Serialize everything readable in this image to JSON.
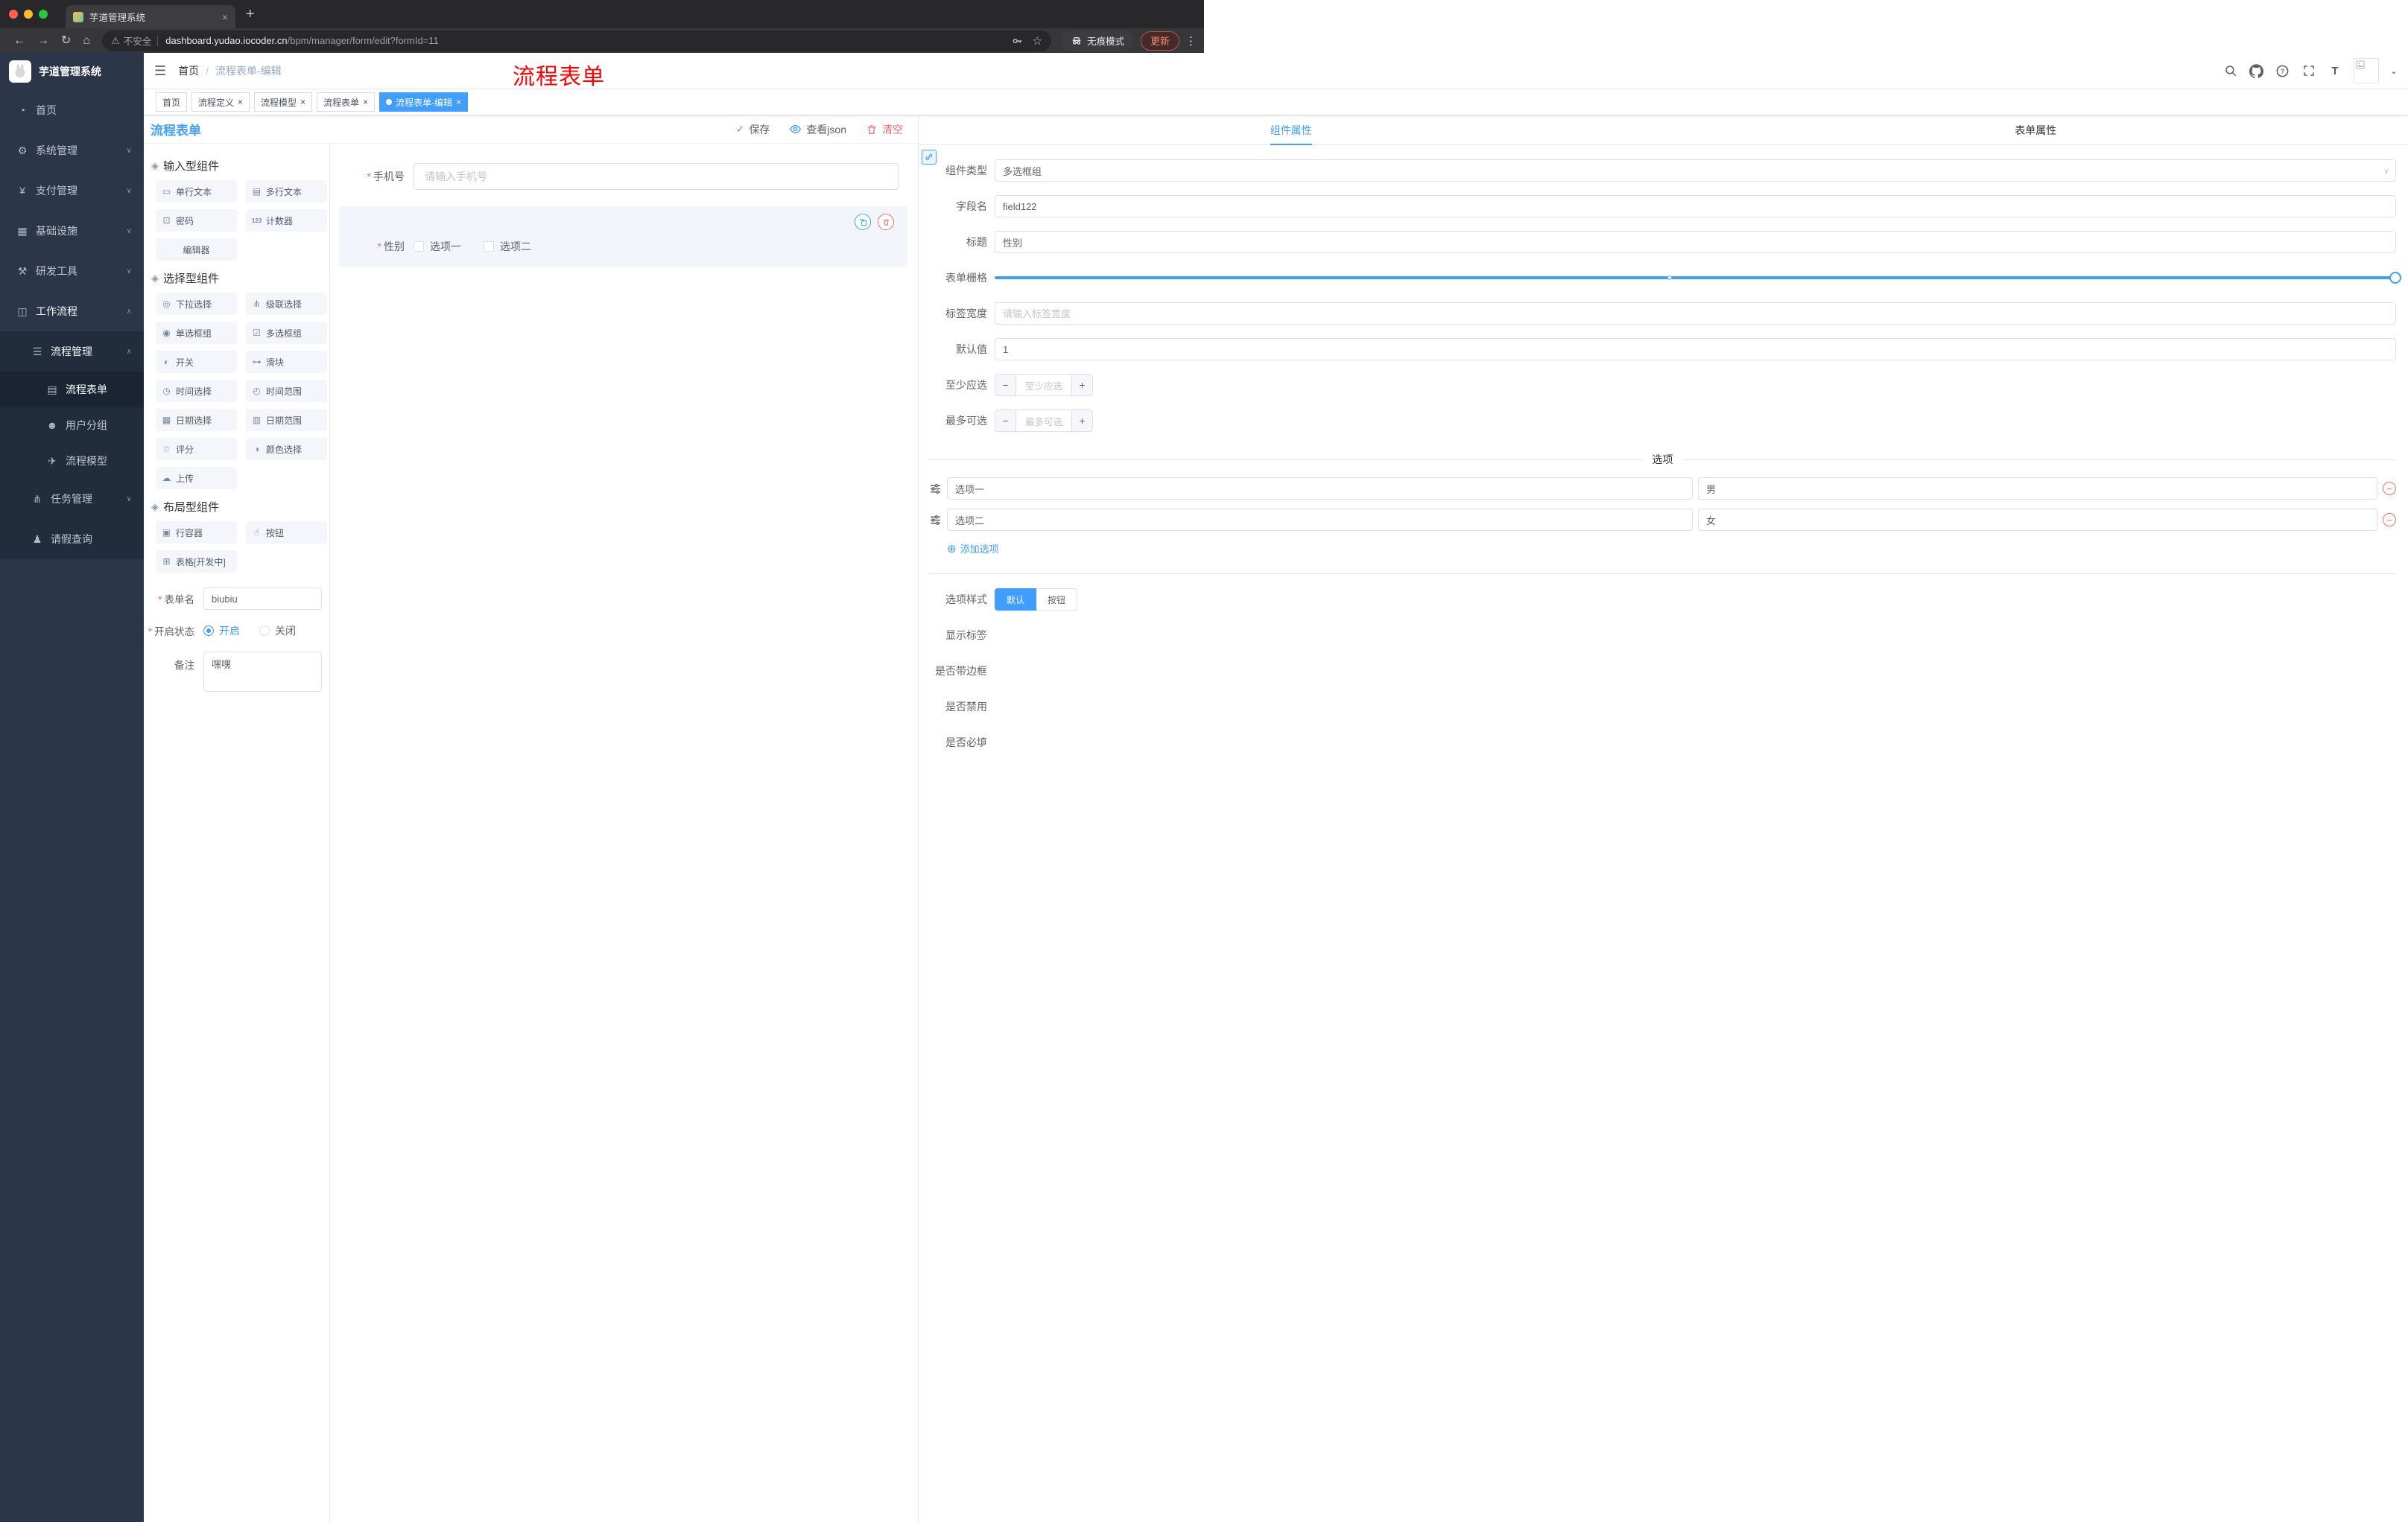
{
  "colors": {
    "accent": "#409eff",
    "danger": "#f56c6c",
    "annotation_red": "#ff0000",
    "sidebar_bg": "#2b3648"
  },
  "icons": {
    "close": "×",
    "plus": "+",
    "back": "←",
    "forward": "→",
    "reload": "↻",
    "home": "⌂",
    "warning": "⚠",
    "star": "☆",
    "dots_vertical": "⋮",
    "hamburger": "☰",
    "chevron_down": "∨",
    "chevron_up": "∧",
    "check": "✓",
    "add_circle": "⊕",
    "minus": "−",
    "slash": "/",
    "caret": "⌄",
    "text_size": "T"
  },
  "browser": {
    "tab_title": "芋道管理系统",
    "security_label": "不安全",
    "url_domain": "dashboard.yudao.iocoder.cn",
    "url_path": "/bpm/manager/form/edit?formId=11",
    "incognito_label": "无痕模式",
    "update_label": "更新"
  },
  "sidebar": {
    "logo_text": "芋道管理系统",
    "items": [
      {
        "label": "首页",
        "icon": "◔"
      },
      {
        "label": "系统管理",
        "icon": "⚙"
      },
      {
        "label": "支付管理",
        "icon": "¥"
      },
      {
        "label": "基础设施",
        "icon": "▦"
      },
      {
        "label": "研发工具",
        "icon": "⚒"
      },
      {
        "label": "工作流程",
        "icon": "◫"
      }
    ],
    "submenu": {
      "process_management": {
        "label": "流程管理",
        "icon": "☰"
      },
      "children": [
        {
          "label": "流程表单",
          "icon": "▤"
        },
        {
          "label": "用户分组",
          "icon": "☻"
        },
        {
          "label": "流程模型",
          "icon": "✈"
        }
      ],
      "task_management": {
        "label": "任务管理",
        "icon": "⋔"
      },
      "leave_query": {
        "label": "请假查询",
        "icon": "♟"
      }
    }
  },
  "header": {
    "breadcrumb": [
      "首页",
      "流程表单-编辑"
    ],
    "annotation": "流程表单"
  },
  "tags": {
    "items": [
      {
        "label": "首页"
      },
      {
        "label": "流程定义"
      },
      {
        "label": "流程模型"
      },
      {
        "label": "流程表单"
      },
      {
        "label": "流程表单-编辑"
      }
    ]
  },
  "designer": {
    "title": "流程表单",
    "actions": {
      "save": "保存",
      "view_json": "查看json",
      "clear": "清空"
    },
    "palette": {
      "sections": [
        {
          "title": "输入型组件",
          "items": [
            {
              "label": "单行文本",
              "icon": "▭"
            },
            {
              "label": "多行文本",
              "icon": "▤"
            },
            {
              "label": "密码",
              "icon": "⊡"
            },
            {
              "label": "计数器",
              "icon": "123"
            },
            {
              "label": "编辑器",
              "icon": ""
            }
          ]
        },
        {
          "title": "选择型组件",
          "items": [
            {
              "label": "下拉选择",
              "icon": "◎"
            },
            {
              "label": "级联选择",
              "icon": "⋔"
            },
            {
              "label": "单选框组",
              "icon": "◉"
            },
            {
              "label": "多选框组",
              "icon": "☑"
            },
            {
              "label": "开关",
              "icon": "◐"
            },
            {
              "label": "滑块",
              "icon": "⊶"
            },
            {
              "label": "时间选择",
              "icon": "◷"
            },
            {
              "label": "时间范围",
              "icon": "◴"
            },
            {
              "label": "日期选择",
              "icon": "▦"
            },
            {
              "label": "日期范围",
              "icon": "▥"
            },
            {
              "label": "评分",
              "icon": "☆"
            },
            {
              "label": "颜色选择",
              "icon": "◑"
            },
            {
              "label": "上传",
              "icon": "☁"
            }
          ]
        },
        {
          "title": "布局型组件",
          "items": [
            {
              "label": "行容器",
              "icon": "▣"
            },
            {
              "label": "按钮",
              "icon": "☝"
            },
            {
              "label": "表格[开发中]",
              "icon": "⊞"
            }
          ]
        }
      ]
    },
    "form_meta": {
      "form_name": {
        "label": "表单名",
        "value": "biubiu"
      },
      "status": {
        "label": "开启状态",
        "options": [
          "开启",
          "关闭"
        ],
        "selected": "开启"
      },
      "remark": {
        "label": "备注",
        "value": "嘿嘿"
      }
    },
    "canvas": {
      "phone": {
        "label": "手机号",
        "placeholder": "请输入手机号"
      },
      "gender": {
        "label": "性别",
        "options": [
          "选项一",
          "选项二"
        ]
      }
    }
  },
  "props": {
    "tabs": [
      {
        "label": "组件属性"
      },
      {
        "label": "表单属性"
      }
    ],
    "component_type": {
      "label": "组件类型",
      "value": "多选框组"
    },
    "field_name": {
      "label": "字段名",
      "value": "field122"
    },
    "title_field": {
      "label": "标题",
      "value": "性别"
    },
    "grid": {
      "label": "表单栅格",
      "value": 24,
      "max": 24
    },
    "label_width": {
      "label": "标签宽度",
      "placeholder": "请输入标签宽度"
    },
    "default_value": {
      "label": "默认值",
      "value": "1"
    },
    "min_select": {
      "label": "至少应选",
      "placeholder": "至少应选"
    },
    "max_select": {
      "label": "最多可选",
      "placeholder": "最多可选"
    },
    "options_title": "选项",
    "options": [
      {
        "label": "选项一",
        "value": "男"
      },
      {
        "label": "选项二",
        "value": "女"
      }
    ],
    "add_option_label": "添加选项",
    "option_style": {
      "label": "选项样式",
      "options": [
        "默认",
        "按钮"
      ],
      "selected": "默认"
    },
    "switches": [
      {
        "label": "显示标签",
        "on": true
      },
      {
        "label": "是否带边框",
        "on": false
      },
      {
        "label": "是否禁用",
        "on": false
      },
      {
        "label": "是否必填",
        "on": true
      }
    ]
  }
}
